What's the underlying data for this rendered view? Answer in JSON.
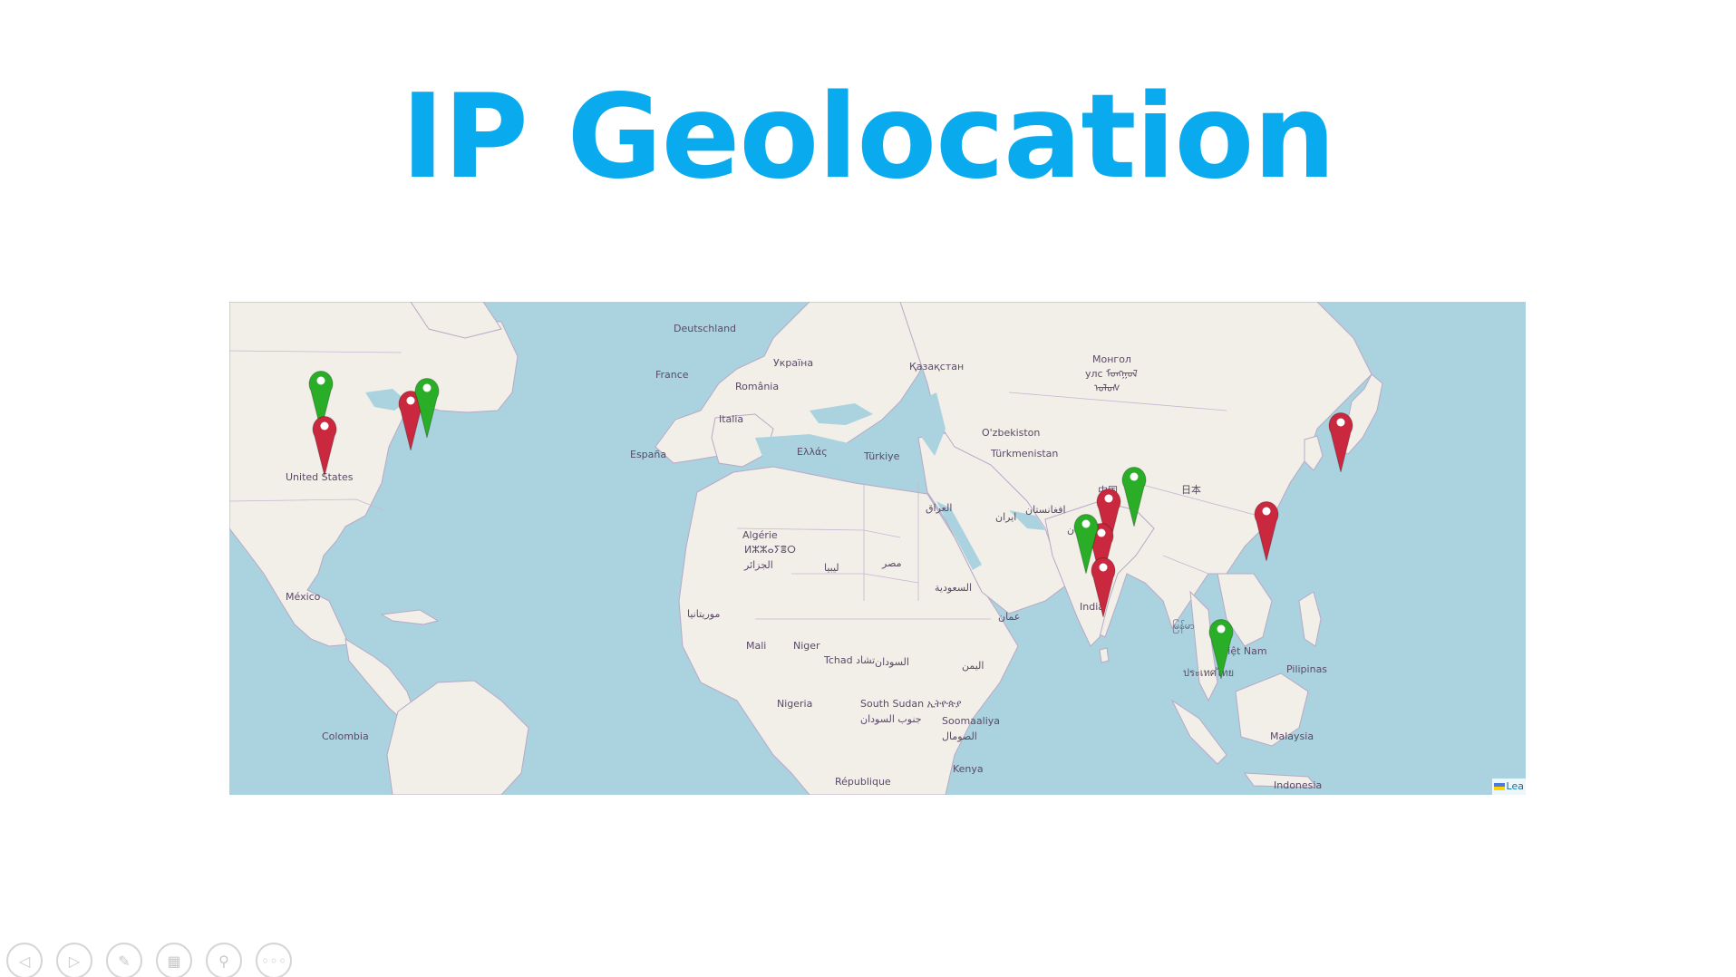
{
  "slide": {
    "title": "IP Geolocation"
  },
  "map": {
    "labels": [
      {
        "text": "Deutschland"
      },
      {
        "text": "France"
      },
      {
        "text": "Україна"
      },
      {
        "text": "România"
      },
      {
        "text": "Қазақстан"
      },
      {
        "text": "Монгол"
      },
      {
        "text": "улс ᠮᠣᠩᠭᠣᠯ"
      },
      {
        "text": "ᠤᠯᠤᠰ"
      },
      {
        "text": "Italia"
      },
      {
        "text": "España"
      },
      {
        "text": "Ελλάς"
      },
      {
        "text": "Türkiye"
      },
      {
        "text": "O'zbekiston"
      },
      {
        "text": "Türkmenistan"
      },
      {
        "text": "United States"
      },
      {
        "text": "中国"
      },
      {
        "text": "日本"
      },
      {
        "text": "افغانستان"
      },
      {
        "text": "العراق"
      },
      {
        "text": "ایران"
      },
      {
        "text": "پاکستان"
      },
      {
        "text": "Algérie"
      },
      {
        "text": "ⵍⵣⵣⴰⵢⴻⵔ"
      },
      {
        "text": "الجزائر"
      },
      {
        "text": "ليبيا"
      },
      {
        "text": "مصر"
      },
      {
        "text": "السعودية"
      },
      {
        "text": "عمان"
      },
      {
        "text": "India"
      },
      {
        "text": "México"
      },
      {
        "text": "موريتانيا"
      },
      {
        "text": "Mali"
      },
      {
        "text": "Niger"
      },
      {
        "text": "Tchad تشاد"
      },
      {
        "text": "السودان"
      },
      {
        "text": "اليمن"
      },
      {
        "text": "မြန်မာ"
      },
      {
        "text": "Việt Nam"
      },
      {
        "text": "Pilipinas"
      },
      {
        "text": "ประเทศไทย"
      },
      {
        "text": "Nigeria"
      },
      {
        "text": "South Sudan ኢትዮጵያ"
      },
      {
        "text": "جنوب السودان"
      },
      {
        "text": "Soomaaliya"
      },
      {
        "text": "الصومال"
      },
      {
        "text": "Colombia"
      },
      {
        "text": "Malaysia"
      },
      {
        "text": "Kenya"
      },
      {
        "text": "République"
      },
      {
        "text": "Indonesia"
      }
    ],
    "markers": [
      {
        "color": "green",
        "location": "Central United States"
      },
      {
        "color": "red",
        "location": "Colorado, United States"
      },
      {
        "color": "red",
        "location": "Ohio, United States"
      },
      {
        "color": "green",
        "location": "New York, United States"
      },
      {
        "color": "green",
        "location": "North India"
      },
      {
        "color": "red",
        "location": "Central India"
      },
      {
        "color": "red",
        "location": "Mumbai, India"
      },
      {
        "color": "green",
        "location": "Western India"
      },
      {
        "color": "red",
        "location": "Bengaluru, India"
      },
      {
        "color": "red",
        "location": "Guangdong, China"
      },
      {
        "color": "red",
        "location": "South Korea"
      },
      {
        "color": "green",
        "location": "Singapore"
      }
    ],
    "attribution": "Lea",
    "colors": {
      "water": "#aad3df",
      "land": "#f2efe9",
      "border": "#b9a8c6",
      "marker_red": "#c9283e",
      "marker_green": "#2aad27"
    }
  },
  "toolbar": {
    "buttons": [
      {
        "name": "previous-slide-button",
        "icon": "◁"
      },
      {
        "name": "next-slide-button",
        "icon": "▷"
      },
      {
        "name": "pen-button",
        "icon": "✎"
      },
      {
        "name": "slides-overview-button",
        "icon": "▦"
      },
      {
        "name": "zoom-button",
        "icon": "⚲"
      },
      {
        "name": "more-options-button",
        "icon": "◦◦◦"
      }
    ]
  },
  "theme": {
    "title_color": "#0aaaee"
  }
}
